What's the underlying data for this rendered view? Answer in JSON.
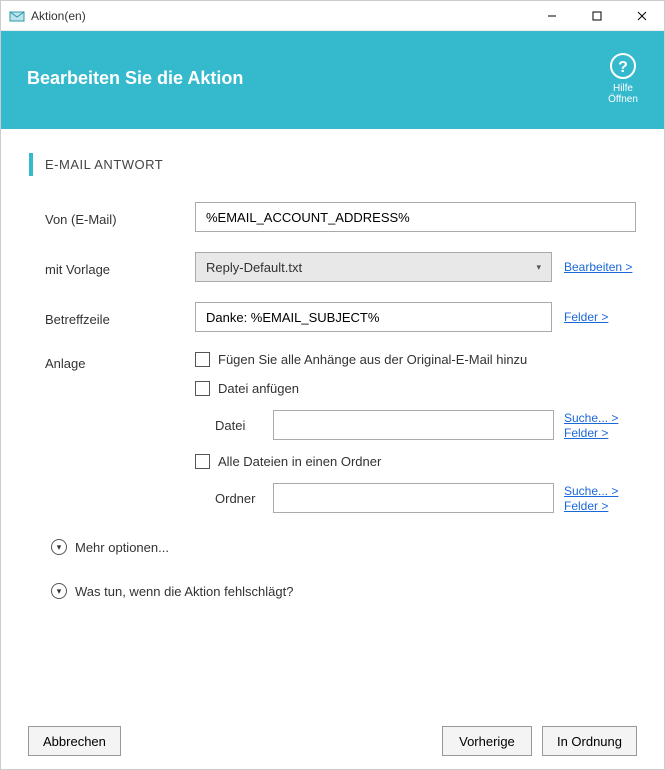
{
  "window": {
    "title": "Aktion(en)"
  },
  "header": {
    "title": "Bearbeiten Sie die Aktion",
    "help_label1": "Hilfe",
    "help_label2": "Öffnen"
  },
  "section_title": "E-MAIL ANTWORT",
  "form": {
    "from_label": "Von (E-Mail)",
    "from_value": "%EMAIL_ACCOUNT_ADDRESS%",
    "template_label": "mit Vorlage",
    "template_value": "Reply-Default.txt",
    "template_edit": "Bearbeiten >",
    "subject_label": "Betreffzeile",
    "subject_value": "Danke: %EMAIL_SUBJECT%",
    "subject_fields": "Felder >",
    "attach_label": "Anlage",
    "attach_all": "Fügen Sie alle Anhänge aus der Original-E-Mail hinzu",
    "attach_file_cb": "Datei anfügen",
    "attach_file_label": "Datei",
    "attach_folder_cb": "Alle Dateien in einen Ordner",
    "attach_folder_label": "Ordner",
    "search_link": "Suche... >",
    "fields_link": "Felder >"
  },
  "expanders": {
    "more": "Mehr optionen...",
    "onfail": "Was tun, wenn die Aktion fehlschlägt?"
  },
  "buttons": {
    "cancel": "Abbrechen",
    "prev": "Vorherige",
    "ok": "In Ordnung"
  }
}
